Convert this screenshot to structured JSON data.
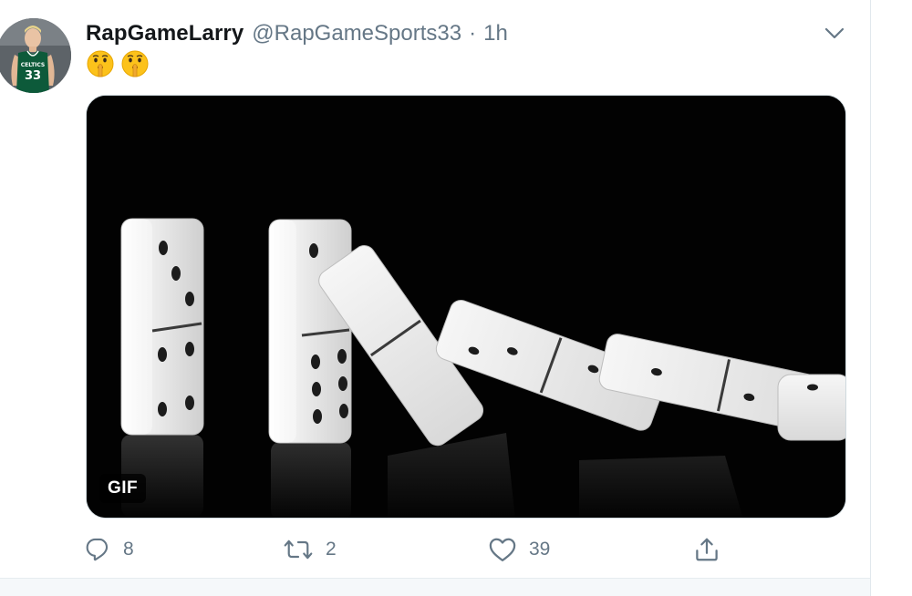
{
  "tweet": {
    "author": {
      "display_name": "RapGameLarry",
      "handle": "@RapGameSports33",
      "separator": "·",
      "time": "1h",
      "avatar_jersey_number": "33",
      "avatar_jersey_text": "CELTICS"
    },
    "text_emojis": [
      "🤫",
      "🤫"
    ],
    "media": {
      "type": "gif",
      "badge": "GIF"
    },
    "actions": {
      "reply_count": "8",
      "retweet_count": "2",
      "like_count": "39"
    }
  },
  "colors": {
    "text_primary": "#14171a",
    "text_secondary": "#657786",
    "border": "#e1e8ed",
    "jersey_green": "#0d5a3a"
  }
}
